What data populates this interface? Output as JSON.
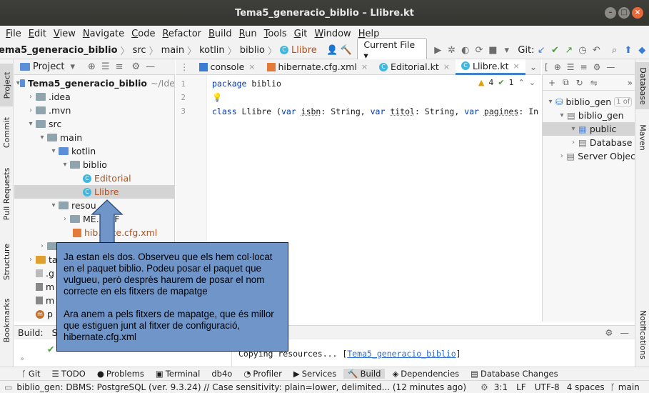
{
  "window": {
    "title": "Tema5_generacio_biblio – Llibre.kt"
  },
  "menu": [
    "File",
    "Edit",
    "View",
    "Navigate",
    "Code",
    "Refactor",
    "Build",
    "Run",
    "Tools",
    "Git",
    "Window",
    "Help"
  ],
  "navbar": {
    "crumbs": [
      "ema5_generacio_biblio",
      "src",
      "main",
      "kotlin",
      "biblio",
      "Llibre"
    ],
    "run_config": "Current File",
    "git_label": "Git:"
  },
  "project_panel": {
    "title": "Project",
    "root": "Tema5_generacio_biblio",
    "root_path": "~/Ide",
    "items": [
      ".idea",
      ".mvn",
      "src",
      "main",
      "kotlin",
      "biblio",
      "Editorial",
      "Llibre",
      "resou",
      "ME…INF",
      "hib…ate.cfg.xml",
      "ta",
      ".g",
      "m",
      "m",
      "p"
    ]
  },
  "editor": {
    "tabs": [
      "console",
      "hibernate.cfg.xml",
      "Editorial.kt",
      "Llibre.kt"
    ],
    "active_tab": "Llibre.kt",
    "line_numbers": [
      "1",
      "2",
      "3"
    ],
    "line1": {
      "keyword": "package",
      "rest": " biblio"
    },
    "line3": {
      "kw_class": "class",
      "name": " Llibre (",
      "kw_var1": "var",
      "p1": "isbn",
      "t1": ": String, ",
      "kw_var2": "var",
      "p2": "titol",
      "t2": ": String, ",
      "kw_var3": "var",
      "p3": "pagines",
      "t3": ": In"
    },
    "warnings": "4",
    "checks": "1"
  },
  "db_panel": {
    "items": [
      "biblio_gen",
      "1 of",
      "biblio_gen",
      "public",
      "Database",
      "Server Objec"
    ]
  },
  "right_strip": [
    "Database",
    "Maven",
    "Notifications"
  ],
  "left_strip": [
    "Project",
    "Commit",
    "Pull Requests",
    "Structure",
    "Bookmarks"
  ],
  "build": {
    "label": "Build:",
    "sync_fragment": "S",
    "lines": [
      "sources",
      "Copying resources... ["
    ],
    "link": "Tema5_generacio_biblio",
    "close_bracket": "]"
  },
  "bottom_tabs": [
    "Git",
    "TODO",
    "Problems",
    "Terminal",
    "db4o",
    "Profiler",
    "Services",
    "Build",
    "Dependencies",
    "Database Changes"
  ],
  "status": {
    "message": "biblio_gen: DBMS: PostgreSQL (ver. 9.3.24) // Case sensitivity: plain=lower, delimited... (12 minutes ago)",
    "position": "3:1",
    "line_sep": "LF",
    "encoding": "UTF-8",
    "indent": "4 spaces",
    "branch": "main"
  },
  "callout": {
    "p1": "Ja estan els dos. Observeu que els hem col·locat en el paquet biblio. Podeu posar el paquet que vulgueu, però desprès haurem de posar el nom correcte en els fitxers de mapatge",
    "p2": "Ara anem a pels fitxers de mapatge, que és millor que estiguen junt al fitxer de configuració, hibernate.cfg.xml"
  }
}
